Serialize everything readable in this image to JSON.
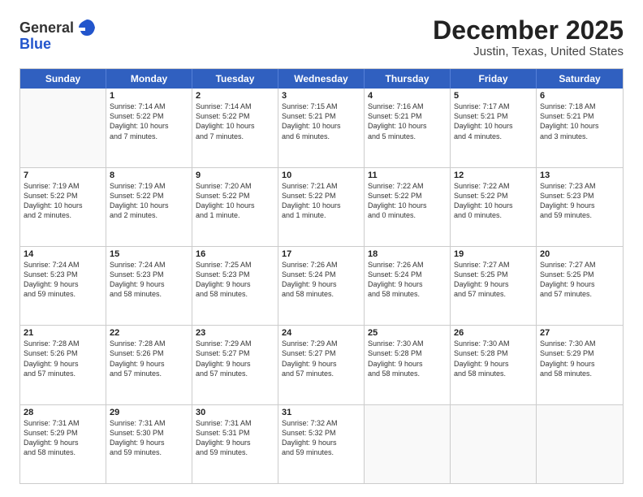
{
  "logo": {
    "general": "General",
    "blue": "Blue"
  },
  "title": "December 2025",
  "subtitle": "Justin, Texas, United States",
  "days": [
    "Sunday",
    "Monday",
    "Tuesday",
    "Wednesday",
    "Thursday",
    "Friday",
    "Saturday"
  ],
  "rows": [
    [
      {
        "day": "",
        "empty": true
      },
      {
        "day": "1",
        "lines": [
          "Sunrise: 7:14 AM",
          "Sunset: 5:22 PM",
          "Daylight: 10 hours",
          "and 7 minutes."
        ]
      },
      {
        "day": "2",
        "lines": [
          "Sunrise: 7:14 AM",
          "Sunset: 5:22 PM",
          "Daylight: 10 hours",
          "and 7 minutes."
        ]
      },
      {
        "day": "3",
        "lines": [
          "Sunrise: 7:15 AM",
          "Sunset: 5:21 PM",
          "Daylight: 10 hours",
          "and 6 minutes."
        ]
      },
      {
        "day": "4",
        "lines": [
          "Sunrise: 7:16 AM",
          "Sunset: 5:21 PM",
          "Daylight: 10 hours",
          "and 5 minutes."
        ]
      },
      {
        "day": "5",
        "lines": [
          "Sunrise: 7:17 AM",
          "Sunset: 5:21 PM",
          "Daylight: 10 hours",
          "and 4 minutes."
        ]
      },
      {
        "day": "6",
        "lines": [
          "Sunrise: 7:18 AM",
          "Sunset: 5:21 PM",
          "Daylight: 10 hours",
          "and 3 minutes."
        ]
      }
    ],
    [
      {
        "day": "7",
        "lines": [
          "Sunrise: 7:19 AM",
          "Sunset: 5:22 PM",
          "Daylight: 10 hours",
          "and 2 minutes."
        ]
      },
      {
        "day": "8",
        "lines": [
          "Sunrise: 7:19 AM",
          "Sunset: 5:22 PM",
          "Daylight: 10 hours",
          "and 2 minutes."
        ]
      },
      {
        "day": "9",
        "lines": [
          "Sunrise: 7:20 AM",
          "Sunset: 5:22 PM",
          "Daylight: 10 hours",
          "and 1 minute."
        ]
      },
      {
        "day": "10",
        "lines": [
          "Sunrise: 7:21 AM",
          "Sunset: 5:22 PM",
          "Daylight: 10 hours",
          "and 1 minute."
        ]
      },
      {
        "day": "11",
        "lines": [
          "Sunrise: 7:22 AM",
          "Sunset: 5:22 PM",
          "Daylight: 10 hours",
          "and 0 minutes."
        ]
      },
      {
        "day": "12",
        "lines": [
          "Sunrise: 7:22 AM",
          "Sunset: 5:22 PM",
          "Daylight: 10 hours",
          "and 0 minutes."
        ]
      },
      {
        "day": "13",
        "lines": [
          "Sunrise: 7:23 AM",
          "Sunset: 5:23 PM",
          "Daylight: 9 hours",
          "and 59 minutes."
        ]
      }
    ],
    [
      {
        "day": "14",
        "lines": [
          "Sunrise: 7:24 AM",
          "Sunset: 5:23 PM",
          "Daylight: 9 hours",
          "and 59 minutes."
        ]
      },
      {
        "day": "15",
        "lines": [
          "Sunrise: 7:24 AM",
          "Sunset: 5:23 PM",
          "Daylight: 9 hours",
          "and 58 minutes."
        ]
      },
      {
        "day": "16",
        "lines": [
          "Sunrise: 7:25 AM",
          "Sunset: 5:23 PM",
          "Daylight: 9 hours",
          "and 58 minutes."
        ]
      },
      {
        "day": "17",
        "lines": [
          "Sunrise: 7:26 AM",
          "Sunset: 5:24 PM",
          "Daylight: 9 hours",
          "and 58 minutes."
        ]
      },
      {
        "day": "18",
        "lines": [
          "Sunrise: 7:26 AM",
          "Sunset: 5:24 PM",
          "Daylight: 9 hours",
          "and 58 minutes."
        ]
      },
      {
        "day": "19",
        "lines": [
          "Sunrise: 7:27 AM",
          "Sunset: 5:25 PM",
          "Daylight: 9 hours",
          "and 57 minutes."
        ]
      },
      {
        "day": "20",
        "lines": [
          "Sunrise: 7:27 AM",
          "Sunset: 5:25 PM",
          "Daylight: 9 hours",
          "and 57 minutes."
        ]
      }
    ],
    [
      {
        "day": "21",
        "lines": [
          "Sunrise: 7:28 AM",
          "Sunset: 5:26 PM",
          "Daylight: 9 hours",
          "and 57 minutes."
        ]
      },
      {
        "day": "22",
        "lines": [
          "Sunrise: 7:28 AM",
          "Sunset: 5:26 PM",
          "Daylight: 9 hours",
          "and 57 minutes."
        ]
      },
      {
        "day": "23",
        "lines": [
          "Sunrise: 7:29 AM",
          "Sunset: 5:27 PM",
          "Daylight: 9 hours",
          "and 57 minutes."
        ]
      },
      {
        "day": "24",
        "lines": [
          "Sunrise: 7:29 AM",
          "Sunset: 5:27 PM",
          "Daylight: 9 hours",
          "and 57 minutes."
        ]
      },
      {
        "day": "25",
        "lines": [
          "Sunrise: 7:30 AM",
          "Sunset: 5:28 PM",
          "Daylight: 9 hours",
          "and 58 minutes."
        ]
      },
      {
        "day": "26",
        "lines": [
          "Sunrise: 7:30 AM",
          "Sunset: 5:28 PM",
          "Daylight: 9 hours",
          "and 58 minutes."
        ]
      },
      {
        "day": "27",
        "lines": [
          "Sunrise: 7:30 AM",
          "Sunset: 5:29 PM",
          "Daylight: 9 hours",
          "and 58 minutes."
        ]
      }
    ],
    [
      {
        "day": "28",
        "lines": [
          "Sunrise: 7:31 AM",
          "Sunset: 5:29 PM",
          "Daylight: 9 hours",
          "and 58 minutes."
        ]
      },
      {
        "day": "29",
        "lines": [
          "Sunrise: 7:31 AM",
          "Sunset: 5:30 PM",
          "Daylight: 9 hours",
          "and 59 minutes."
        ]
      },
      {
        "day": "30",
        "lines": [
          "Sunrise: 7:31 AM",
          "Sunset: 5:31 PM",
          "Daylight: 9 hours",
          "and 59 minutes."
        ]
      },
      {
        "day": "31",
        "lines": [
          "Sunrise: 7:32 AM",
          "Sunset: 5:32 PM",
          "Daylight: 9 hours",
          "and 59 minutes."
        ]
      },
      {
        "day": "",
        "empty": true
      },
      {
        "day": "",
        "empty": true
      },
      {
        "day": "",
        "empty": true
      }
    ]
  ]
}
